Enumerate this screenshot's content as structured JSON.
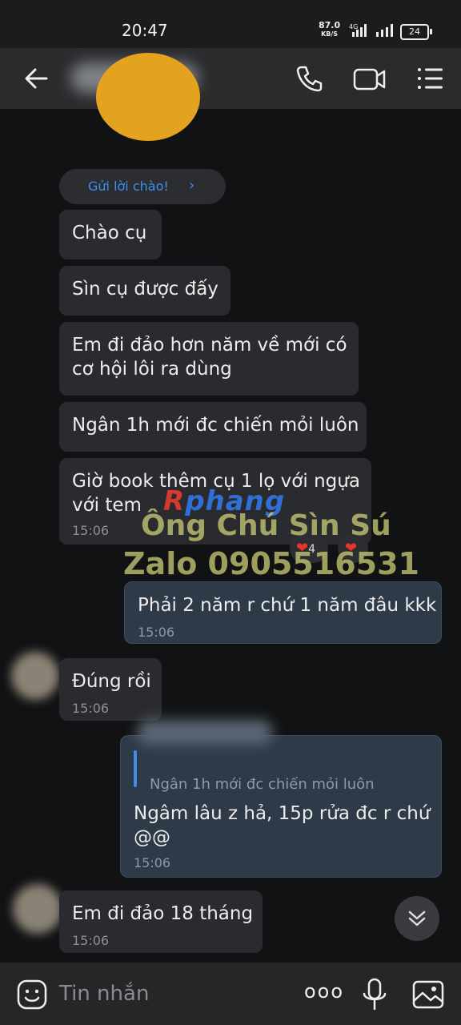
{
  "status_bar": {
    "time": "20:47",
    "net_speed_value": "87.0",
    "net_speed_unit": "KB/S",
    "network_type": "4G",
    "battery": "24"
  },
  "header": {
    "icons": [
      "back-arrow-icon",
      "phone-icon",
      "video-call-icon",
      "menu-icon"
    ]
  },
  "greeting_chip": {
    "label": "Gửi lời chào!",
    "chevron": "›"
  },
  "messages": [
    {
      "text": "Chào cụ"
    },
    {
      "text": "Sìn cụ được đấy"
    },
    {
      "text": "Em đi đảo hơn năm về mới có\ncơ hội lôi ra dùng"
    },
    {
      "text": "Ngân 1h mới đc chiến mỏi luôn"
    },
    {
      "text": "Giờ book thêm cụ 1 lọ với ngựa\nvới tem",
      "time": "15:06"
    },
    {
      "text": "Phải 2 năm r chứ 1 năm đâu kkk",
      "time": "15:06"
    },
    {
      "text": "Đúng rồi",
      "time": "15:06"
    },
    {
      "quote": "Ngân 1h mới đc chiến mỏi luôn",
      "text": "Ngâm lâu z hả, 15p rửa đc r chứ\n@@",
      "time": "15:06"
    },
    {
      "text": "Em đi đảo 18 tháng",
      "time": "15:06"
    }
  ],
  "reactions": [
    {
      "icon": "heart",
      "count": "4"
    },
    {
      "icon": "heart"
    }
  ],
  "watermark": {
    "logo_prefix": "R",
    "logo_rest": "phang",
    "line1": "Ông Chú Sìn Sú",
    "line2": "Zalo 0905516531"
  },
  "input_bar": {
    "placeholder": "Tin nhắn",
    "more_label": "ooo"
  }
}
